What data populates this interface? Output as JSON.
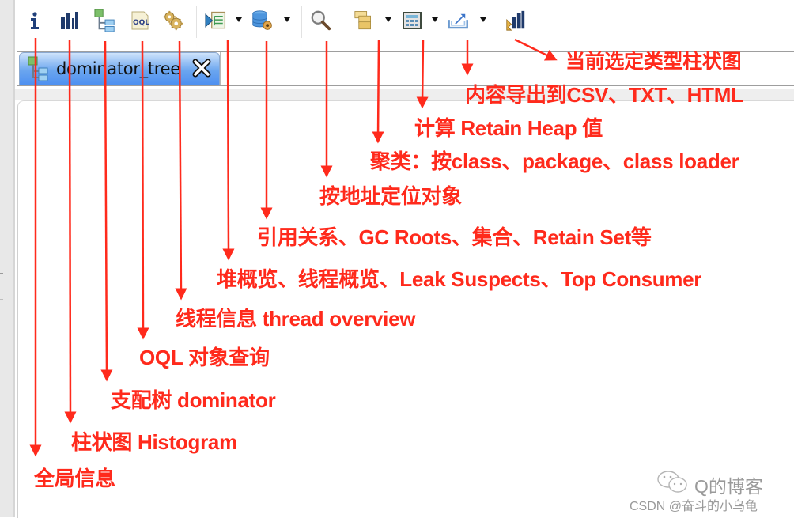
{
  "toolbar": {
    "items": [
      {
        "id": "overview",
        "icon": "info-icon",
        "tooltip": "Overview"
      },
      {
        "id": "histogram",
        "icon": "histogram-icon"
      },
      {
        "id": "dominator_tree",
        "icon": "dominator-tree-icon"
      },
      {
        "id": "oql",
        "icon": "oql-icon",
        "glyph": "OQL"
      },
      {
        "id": "thread_overview",
        "icon": "gears-icon"
      },
      {
        "id": "reports",
        "icon": "report-list-icon",
        "has_dropdown": true
      },
      {
        "id": "query_browser",
        "icon": "database-gear-icon",
        "has_dropdown": true
      },
      {
        "id": "find_object",
        "icon": "magnifier-icon"
      },
      {
        "id": "group_by",
        "icon": "group-windows-icon",
        "has_dropdown": true
      },
      {
        "id": "calculate_retained",
        "icon": "calculator-icon",
        "has_dropdown": true
      },
      {
        "id": "export",
        "icon": "export-icon",
        "has_dropdown": true
      },
      {
        "id": "type_histogram",
        "icon": "type-histogram-icon"
      }
    ]
  },
  "editor": {
    "tabs": [
      {
        "label": "dominator_tree",
        "icon": "dominator-tree-icon",
        "active": true,
        "closable": true
      }
    ]
  },
  "annotations": {
    "type_histogram": "当前选定类型柱状图",
    "export": "内容导出到CSV、TXT、HTML",
    "calculate_retained": "计算 Retain Heap 值",
    "group_by": "聚类：按class、package、class loader",
    "find_object": "按地址定位对象",
    "query_browser": "引用关系、GC Roots、集合、Retain Set等",
    "reports": "堆概览、线程概览、Leak Suspects、Top Consumer",
    "thread_overview": "线程信息 thread overview",
    "oql": "OQL 对象查询",
    "dominator_tree": "支配树 dominator",
    "histogram": "柱状图 Histogram",
    "overview": "全局信息"
  },
  "watermark": {
    "line1": "Q的博客",
    "line2": "CSDN @奋斗的小乌龟"
  },
  "colors": {
    "annotation": "#ff2a1c",
    "tab_active": "#4d8ff0",
    "icon_blue": "#1f3f7a"
  }
}
